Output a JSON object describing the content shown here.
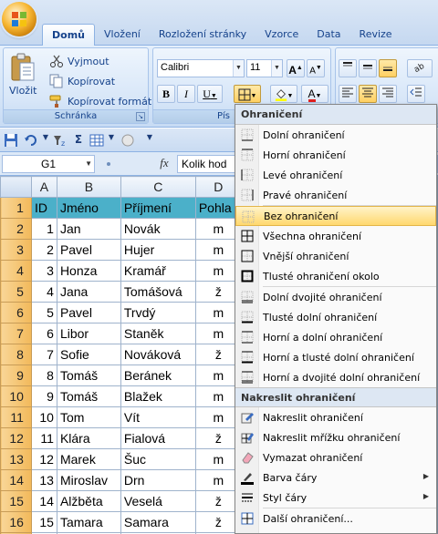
{
  "tabs": [
    "Domů",
    "Vložení",
    "Rozložení stránky",
    "Vzorce",
    "Data",
    "Revize"
  ],
  "active_tab": "Domů",
  "clipboard": {
    "paste_label": "Vložit",
    "cut_label": "Vyjmout",
    "copy_label": "Kopírovat",
    "format_painter_label": "Kopírovat formát",
    "group_label": "Schránka"
  },
  "font": {
    "name": "Calibri",
    "size": "11",
    "bold": "B",
    "italic": "I",
    "underline": "U",
    "grow": "A",
    "shrink": "A",
    "group_label_partial": "Pís"
  },
  "formula_bar": {
    "cell_ref": "G1",
    "fx": "fx",
    "content": "Kolik hod"
  },
  "sheet": {
    "columns": [
      "A",
      "B",
      "C",
      "D"
    ],
    "header_row": [
      "ID",
      "Jméno",
      "Příjmení",
      "Pohla"
    ],
    "rows": [
      [
        "1",
        "Jan",
        "Novák",
        "m"
      ],
      [
        "2",
        "Pavel",
        "Hujer",
        "m"
      ],
      [
        "3",
        "Honza",
        "Kramář",
        "m"
      ],
      [
        "4",
        "Jana",
        "Tomášová",
        "ž"
      ],
      [
        "5",
        "Pavel",
        "Trvdý",
        "m"
      ],
      [
        "6",
        "Libor",
        "Staněk",
        "m"
      ],
      [
        "7",
        "Sofie",
        "Nováková",
        "ž"
      ],
      [
        "8",
        "Tomáš",
        "Beránek",
        "m"
      ],
      [
        "9",
        "Tomáš",
        "Blažek",
        "m"
      ],
      [
        "10",
        "Tom",
        "Vít",
        "m"
      ],
      [
        "11",
        "Klára",
        "Fialová",
        "ž"
      ],
      [
        "12",
        "Marek",
        "Šuc",
        "m"
      ],
      [
        "13",
        "Miroslav",
        "Drn",
        "m"
      ],
      [
        "14",
        "Alžběta",
        "Veselá",
        "ž"
      ],
      [
        "15",
        "Tamara",
        "Samara",
        "ž"
      ]
    ],
    "row_numbers": [
      "1",
      "2",
      "3",
      "4",
      "5",
      "6",
      "7",
      "8",
      "9",
      "10",
      "11",
      "12",
      "13",
      "14",
      "15",
      "16"
    ],
    "header_fill": "#4bb0c9"
  },
  "borders_menu": {
    "header": "Ohraničení",
    "items": [
      {
        "label": "Dolní ohraničení",
        "icon": "border-bottom-icon"
      },
      {
        "label": "Horní ohraničení",
        "icon": "border-top-icon"
      },
      {
        "label": "Levé ohraničení",
        "icon": "border-left-icon"
      },
      {
        "label": "Pravé ohraničení",
        "icon": "border-right-icon"
      },
      {
        "label": "Bez ohraničení",
        "icon": "no-border-icon",
        "highlighted": true
      },
      {
        "label": "Všechna ohraničení",
        "icon": "all-borders-icon"
      },
      {
        "label": "Vnější ohraničení",
        "icon": "outside-borders-icon"
      },
      {
        "label": "Tlusté ohraničení okolo",
        "icon": "thick-box-border-icon"
      },
      {
        "label": "Dolní dvojité ohraničení",
        "icon": "bottom-double-border-icon"
      },
      {
        "label": "Tlusté dolní ohraničení",
        "icon": "thick-bottom-border-icon"
      },
      {
        "label": "Horní a dolní ohraničení",
        "icon": "top-bottom-border-icon"
      },
      {
        "label": "Horní a tlusté dolní ohraničení",
        "icon": "top-thick-bottom-border-icon"
      },
      {
        "label": "Horní a dvojité dolní ohraničení",
        "icon": "top-double-bottom-border-icon"
      }
    ],
    "draw_header": "Nakreslit ohraničení",
    "draw_items": [
      {
        "label": "Nakreslit ohraničení",
        "icon": "draw-border-icon"
      },
      {
        "label": "Nakreslit mřížku ohraničení",
        "icon": "draw-border-grid-icon"
      },
      {
        "label": "Vymazat ohraničení",
        "icon": "erase-border-icon"
      },
      {
        "label": "Barva čáry",
        "icon": "line-color-icon",
        "submenu": true
      },
      {
        "label": "Styl čáry",
        "icon": "line-style-icon",
        "submenu": true
      },
      {
        "label": "Další ohraničení...",
        "icon": "more-borders-icon"
      }
    ]
  },
  "colors": {
    "ribbon": "#d5e5f8",
    "row_header": "#f2b95a",
    "highlight": "#ffd86e",
    "font_color_bar": "#e02020",
    "fill_color_bar": "#ffff00"
  }
}
